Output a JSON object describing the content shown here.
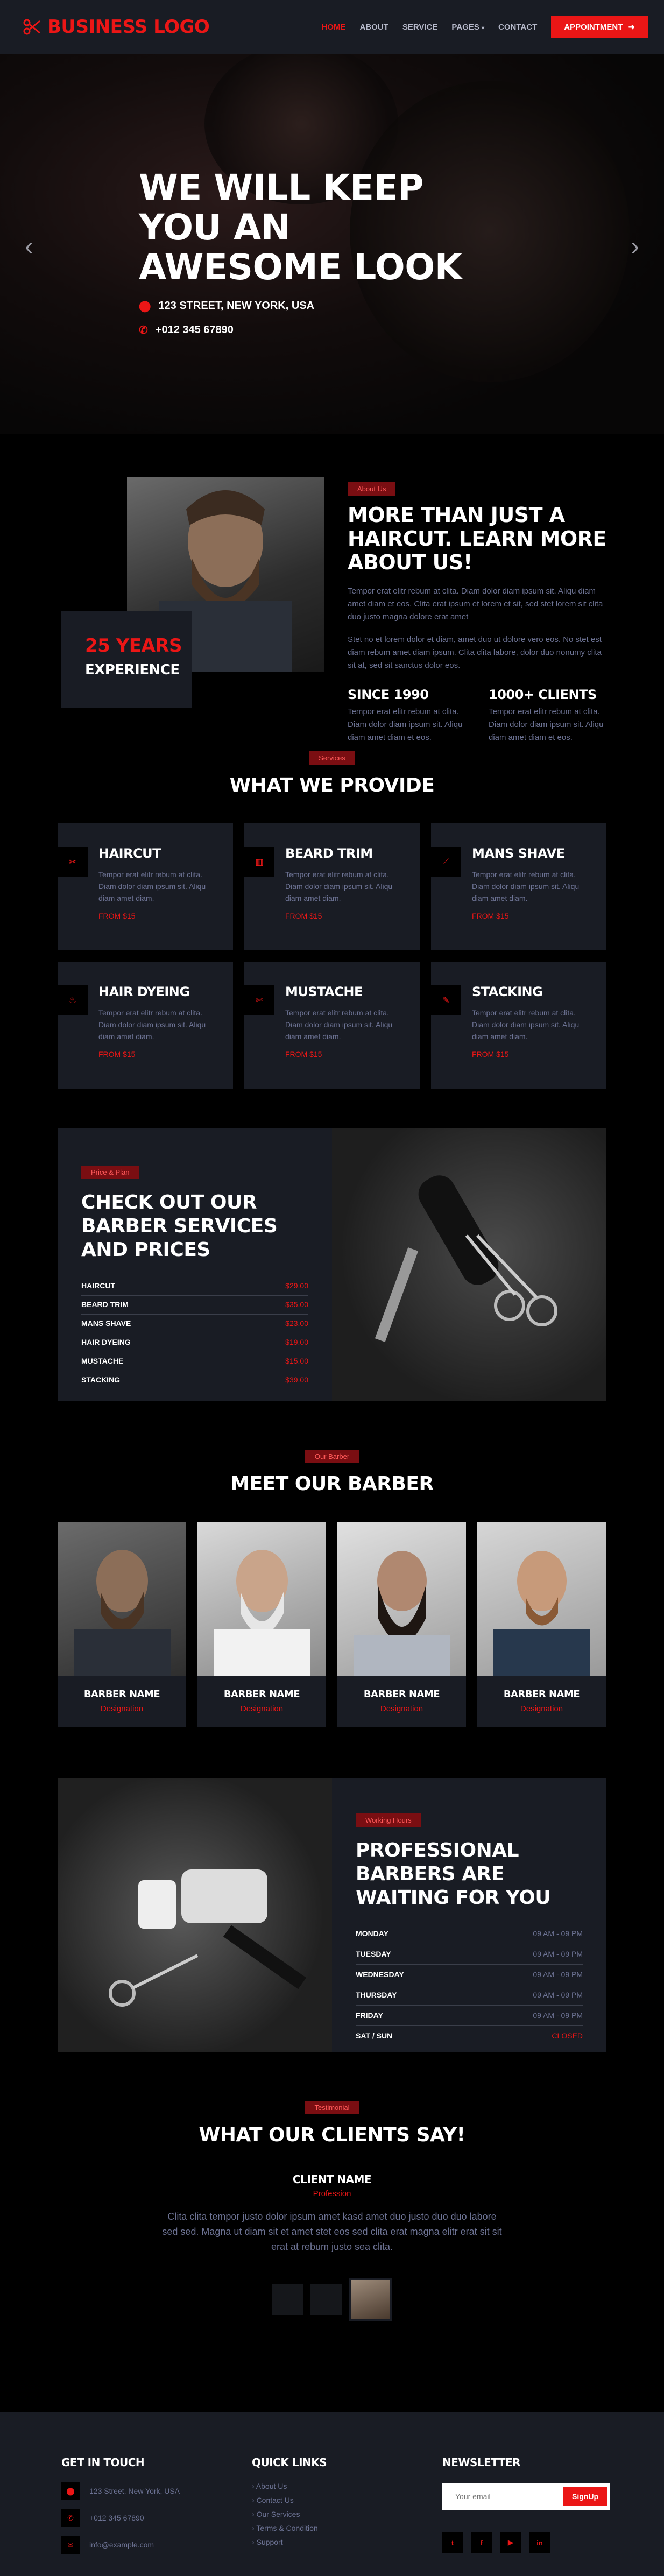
{
  "nav": {
    "logo": "BUSINESS LOGO",
    "items": [
      {
        "label": "HOME"
      },
      {
        "label": "ABOUT"
      },
      {
        "label": "SERVICE"
      },
      {
        "label": "PAGES"
      },
      {
        "label": "CONTACT"
      }
    ],
    "cta": "Appointment"
  },
  "hero": {
    "title": "WE WILL KEEP YOU AN AWESOME LOOK",
    "address": "123 STREET, NEW YORK, USA",
    "phone": "+012 345 67890"
  },
  "about": {
    "years": "25 YEARS",
    "experience": "EXPERIENCE",
    "tag": "About Us",
    "title": "MORE THAN JUST A HAIRCUT. LEARN MORE ABOUT US!",
    "p1": "Tempor erat elitr rebum at clita. Diam dolor diam ipsum sit. Aliqu diam amet diam et eos. Clita erat ipsum et lorem et sit, sed stet lorem sit clita duo justo magna dolore erat amet",
    "p2": "Stet no et lorem dolor et diam, amet duo ut dolore vero eos. No stet est diam rebum amet diam ipsum. Clita clita labore, dolor duo nonumy clita sit at, sed sit sanctus dolor eos.",
    "stat1_title": "SINCE 1990",
    "stat1_text": "Tempor erat elitr rebum at clita. Diam dolor diam ipsum sit. Aliqu diam amet diam et eos.",
    "stat2_title": "1000+ CLIENTS",
    "stat2_text": "Tempor erat elitr rebum at clita. Diam dolor diam ipsum sit. Aliqu diam amet diam et eos."
  },
  "services": {
    "tag": "Services",
    "title": "WHAT WE PROVIDE",
    "items": [
      {
        "name": "HAIRCUT",
        "text": "Tempor erat elitr rebum at clita. Diam dolor diam ipsum sit. Aliqu diam amet diam.",
        "price": "FROM $15"
      },
      {
        "name": "BEARD TRIM",
        "text": "Tempor erat elitr rebum at clita. Diam dolor diam ipsum sit. Aliqu diam amet diam.",
        "price": "FROM $15"
      },
      {
        "name": "MANS SHAVE",
        "text": "Tempor erat elitr rebum at clita. Diam dolor diam ipsum sit. Aliqu diam amet diam.",
        "price": "FROM $15"
      },
      {
        "name": "HAIR DYEING",
        "text": "Tempor erat elitr rebum at clita. Diam dolor diam ipsum sit. Aliqu diam amet diam.",
        "price": "FROM $15"
      },
      {
        "name": "MUSTACHE",
        "text": "Tempor erat elitr rebum at clita. Diam dolor diam ipsum sit. Aliqu diam amet diam.",
        "price": "FROM $15"
      },
      {
        "name": "STACKING",
        "text": "Tempor erat elitr rebum at clita. Diam dolor diam ipsum sit. Aliqu diam amet diam.",
        "price": "FROM $15"
      }
    ]
  },
  "pricing": {
    "tag": "Price & Plan",
    "title": "CHECK OUT OUR BARBER SERVICES AND PRICES",
    "rows": [
      {
        "name": "HAIRCUT",
        "price": "$29.00"
      },
      {
        "name": "BEARD TRIM",
        "price": "$35.00"
      },
      {
        "name": "MANS SHAVE",
        "price": "$23.00"
      },
      {
        "name": "HAIR DYEING",
        "price": "$19.00"
      },
      {
        "name": "MUSTACHE",
        "price": "$15.00"
      },
      {
        "name": "STACKING",
        "price": "$39.00"
      }
    ]
  },
  "team": {
    "tag": "Our Barber",
    "title": "MEET OUR BARBER",
    "members": [
      {
        "name": "BARBER NAME",
        "role": "Designation"
      },
      {
        "name": "BARBER NAME",
        "role": "Designation"
      },
      {
        "name": "BARBER NAME",
        "role": "Designation"
      },
      {
        "name": "BARBER NAME",
        "role": "Designation"
      }
    ]
  },
  "hours": {
    "tag": "Working Hours",
    "title": "PROFESSIONAL BARBERS ARE WAITING FOR YOU",
    "rows": [
      {
        "day": "MONDAY",
        "time": "09 AM - 09 PM"
      },
      {
        "day": "TUESDAY",
        "time": "09 AM - 09 PM"
      },
      {
        "day": "WEDNESDAY",
        "time": "09 AM - 09 PM"
      },
      {
        "day": "THURSDAY",
        "time": "09 AM - 09 PM"
      },
      {
        "day": "FRIDAY",
        "time": "09 AM - 09 PM"
      },
      {
        "day": "SAT / SUN",
        "time": "CLOSED"
      }
    ]
  },
  "testimonial": {
    "tag": "Testimonial",
    "title": "WHAT OUR CLIENTS SAY!",
    "name": "CLIENT NAME",
    "profession": "Profession",
    "quote": "Clita clita tempor justo dolor ipsum amet kasd amet duo justo duo duo labore sed sed. Magna ut diam sit et amet stet eos sed clita erat magna elitr erat sit sit erat at rebum justo sea clita."
  },
  "footer": {
    "contact_title": "GET IN TOUCH",
    "address": "123 Street, New York, USA",
    "phone": "+012 345 67890",
    "email": "info@example.com",
    "links_title": "QUICK LINKS",
    "links": [
      "About Us",
      "Contact Us",
      "Our Services",
      "Terms & Condition",
      "Support"
    ],
    "newsletter_title": "NEWSLETTER",
    "email_placeholder": "Your email",
    "signup": "SignUp",
    "social": [
      "t",
      "f",
      "▶",
      "in"
    ]
  },
  "colors": {
    "accent": "#eb1616",
    "panel": "#191c24",
    "muted": "#6c7293"
  }
}
